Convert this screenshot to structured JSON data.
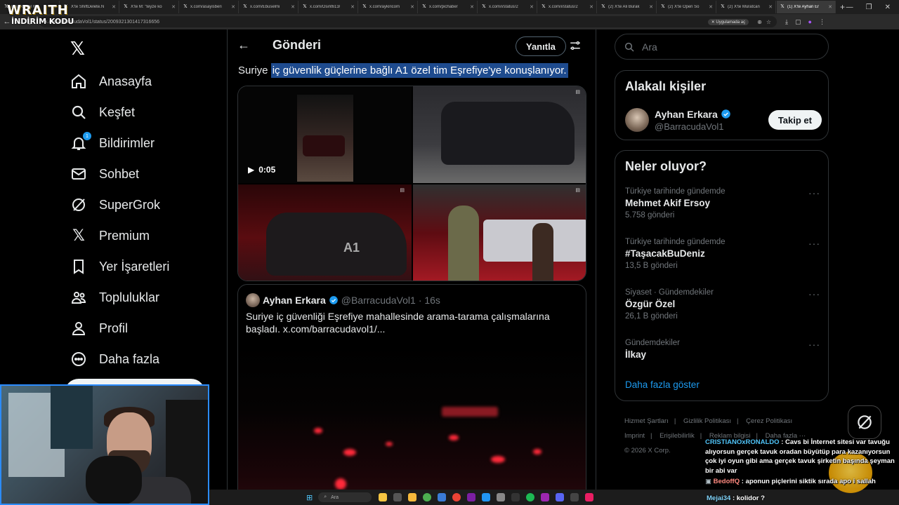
{
  "overlay": {
    "brand_line1": "WRAITH",
    "brand_line2": "İNDİRİM KODU"
  },
  "browser": {
    "tabs": [
      {
        "label": "PlatDot Lol K",
        "active": false
      },
      {
        "label": "X'te ShiftDelete.N",
        "active": false
      },
      {
        "label": "X'te M: \"teyze ko",
        "active": false
      },
      {
        "label": "x.com/asayisberi",
        "active": false
      },
      {
        "label": "x.com/Ebuselmi",
        "active": false
      },
      {
        "label": "x.com/Osint613/",
        "active": false
      },
      {
        "label": "x.com/aykiricom",
        "active": false
      },
      {
        "label": "x.com/pichaber",
        "active": false
      },
      {
        "label": "x.com/i/status/2",
        "active": false
      },
      {
        "label": "x.com/i/status/2",
        "active": false
      },
      {
        "label": "(2) X'te Ali Burak",
        "active": false
      },
      {
        "label": "(2) X'te Open So",
        "active": false
      },
      {
        "label": "(2) X'te Muratcan",
        "active": false
      },
      {
        "label": "(1) X'te Ayhan Er",
        "active": true
      }
    ],
    "url": "x.com/BarracudaVol1/status/2009321301417316656",
    "open_in_app": "Uygulamada aç"
  },
  "nav": {
    "items": [
      {
        "label": "Anasayfa",
        "icon": "home-icon"
      },
      {
        "label": "Keşfet",
        "icon": "search-icon"
      },
      {
        "label": "Bildirimler",
        "icon": "bell-icon",
        "badge": "1"
      },
      {
        "label": "Sohbet",
        "icon": "mail-icon"
      },
      {
        "label": "SuperGrok",
        "icon": "grok-icon"
      },
      {
        "label": "Premium",
        "icon": "x-icon"
      },
      {
        "label": "Yer İşaretleri",
        "icon": "bookmark-icon"
      },
      {
        "label": "Topluluklar",
        "icon": "communities-icon"
      },
      {
        "label": "Profil",
        "icon": "profile-icon"
      },
      {
        "label": "Daha fazla",
        "icon": "more-circle-icon"
      }
    ]
  },
  "post": {
    "header_title": "Gönderi",
    "reply_label": "Yanıtla",
    "text_plain": "Suriye ",
    "text_highlight": "iç güvenlik güçlerine bağlı A1 özel tim Eşrefiye'ye konuşlanıyor.",
    "video_duration": "0:05",
    "car_mark": "A1",
    "quote": {
      "name": "Ayhan Erkara",
      "handle": "@BarracudaVol1",
      "time": "· 16s",
      "text": "Suriye iç güvenliği Eşrefiye mahallesinde arama-tarama çalışmalarına başladı. x.com/barracudavol1/..."
    }
  },
  "right": {
    "search_placeholder": "Ara",
    "related_title": "Alakalı kişiler",
    "person": {
      "name": "Ayhan Erkara",
      "handle": "@BarracudaVol1",
      "follow_label": "Takip et"
    },
    "trends_title": "Neler oluyor?",
    "trends": [
      {
        "category": "Türkiye tarihinde gündemde",
        "name": "Mehmet Akif Ersoy",
        "count": "5.758 gönderi"
      },
      {
        "category": "Türkiye tarihinde gündemde",
        "name": "#TaşacakBuDeniz",
        "count": "13,5 B gönderi"
      },
      {
        "category": "Siyaset · Gündemdekiler",
        "name": "Özgür Özel",
        "count": "26,1 B gönderi"
      },
      {
        "category": "Gündemdekiler",
        "name": "İlkay",
        "count": ""
      }
    ],
    "show_more": "Daha fazla göster",
    "footer": {
      "links_row1": [
        "Hizmet Şartları",
        "Gizlilik Politikası",
        "Çerez Politikası"
      ],
      "links_row2": [
        "Imprint",
        "Erişilebilirlik",
        "Reklam bilgisi",
        "Daha fazla ···"
      ],
      "copyright": "© 2026 X Corp."
    }
  },
  "chat": [
    {
      "user": "CRISTIANOxRONALDO",
      "color": "#4fc3f7",
      "message": ": Cavs bi İnternet sitesi var tavuğu alıyorsun gerçek tavuk oradan büyütüp para kazanıyorsun çok iyi oyun gibi ama gerçek tavuk şirketin başında şeyman bir abi var"
    },
    {
      "user": "BedoffQ",
      "color": "#ff8a80",
      "message": ": aponun piçlerini siktik sırada apo i sallah"
    },
    {
      "user": "Mejai34",
      "color": "#81d4fa",
      "message": ": kolidor ?"
    }
  ],
  "taskbar": {
    "search_placeholder": "Ara"
  },
  "colors": {
    "accent": "#1d9bf0",
    "highlight": "#1e4b8e",
    "background": "#000000",
    "border": "#2f3336"
  }
}
